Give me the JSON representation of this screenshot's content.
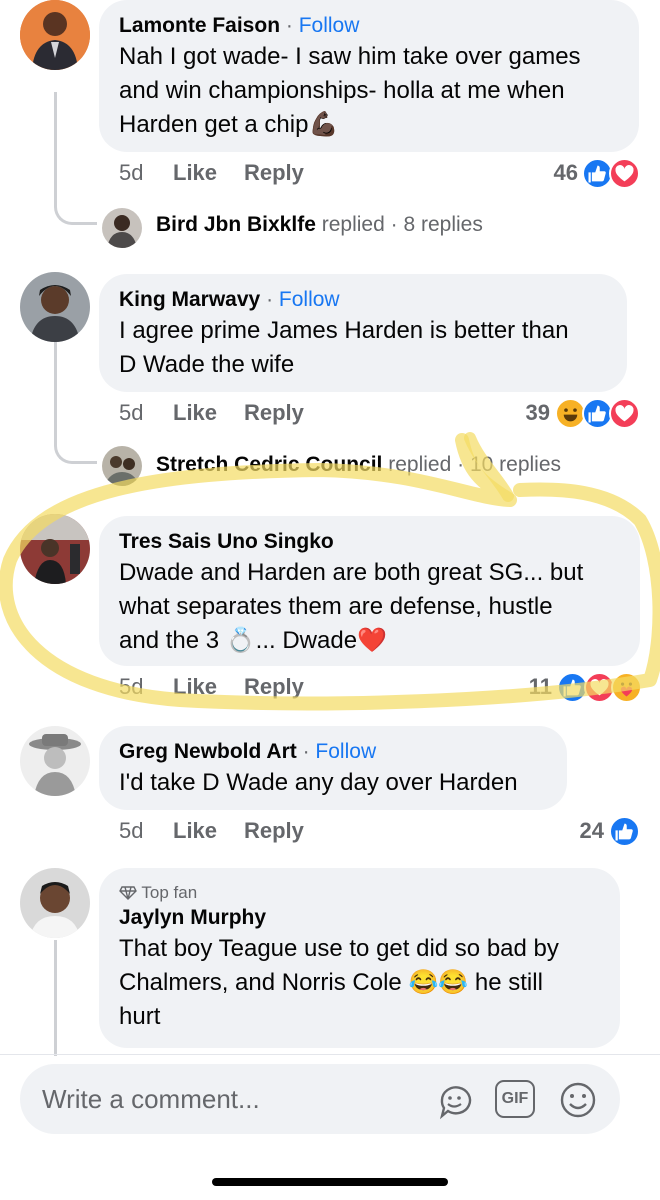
{
  "comments": [
    {
      "author": "Lamonte Faison",
      "follow": "Follow",
      "separator": "·",
      "lines": [
        "Nah I got wade- I saw him take over games",
        "and win championships- holla at me when",
        "Harden get a chip"
      ],
      "emoji": "💪🏿",
      "time": "5d",
      "like": "Like",
      "reply": "Reply",
      "reactions_count": "46",
      "reactions": [
        "like-reaction",
        "love-reaction"
      ],
      "thread": {
        "name": "Bird Jbn Bixklfe",
        "verb": "replied",
        "sep": "·",
        "count": "8 replies"
      }
    },
    {
      "author": "King Marwavy",
      "follow": "Follow",
      "separator": "·",
      "lines": [
        "I agree prime James Harden is better than",
        "D Wade the wife"
      ],
      "time": "5d",
      "like": "Like",
      "reply": "Reply",
      "reactions_count": "39",
      "reactions": [
        "haha-reaction",
        "like-reaction",
        "love-reaction"
      ],
      "thread": {
        "name": "Stretch Cedric Council",
        "verb": "replied",
        "sep": "·",
        "count": "10 replies"
      }
    },
    {
      "author": "Tres Sais Uno Singko",
      "lines": [
        "Dwade and Harden are both great SG... but",
        "what separates them are defense, hustle",
        "and the 3"
      ],
      "ring": "💍",
      "after_ring": "... Dwade",
      "heart": "❤️",
      "time": "5d",
      "like": "Like",
      "reply": "Reply",
      "reactions_count": "11",
      "reactions": [
        "like-reaction",
        "love-reaction",
        "care-reaction"
      ]
    },
    {
      "author": "Greg Newbold Art",
      "follow": "Follow",
      "separator": "·",
      "lines": [
        "I'd take D Wade any day over Harden"
      ],
      "time": "5d",
      "like": "Like",
      "reply": "Reply",
      "reactions_count": "24",
      "reactions": [
        "like-reaction"
      ]
    },
    {
      "badge": "Top fan",
      "author": "Jaylyn Murphy",
      "lines": [
        "That boy Teague use to get did so bad by",
        "Chalmers, and Norris Cole",
        "hurt"
      ],
      "laugh_emoji": "😂😂",
      "line2_tail": "he still"
    }
  ],
  "composer": {
    "placeholder": "Write a comment...",
    "icons": [
      "sticker-icon",
      "gif-icon",
      "emoji-icon"
    ],
    "gif_label": "GIF"
  },
  "colors": {
    "bubble": "#f0f2f5",
    "accent": "#1877f2",
    "meta": "#65676b",
    "highlight": "#f6e05e",
    "love": "#f33e58",
    "haha": "#f7b125"
  }
}
